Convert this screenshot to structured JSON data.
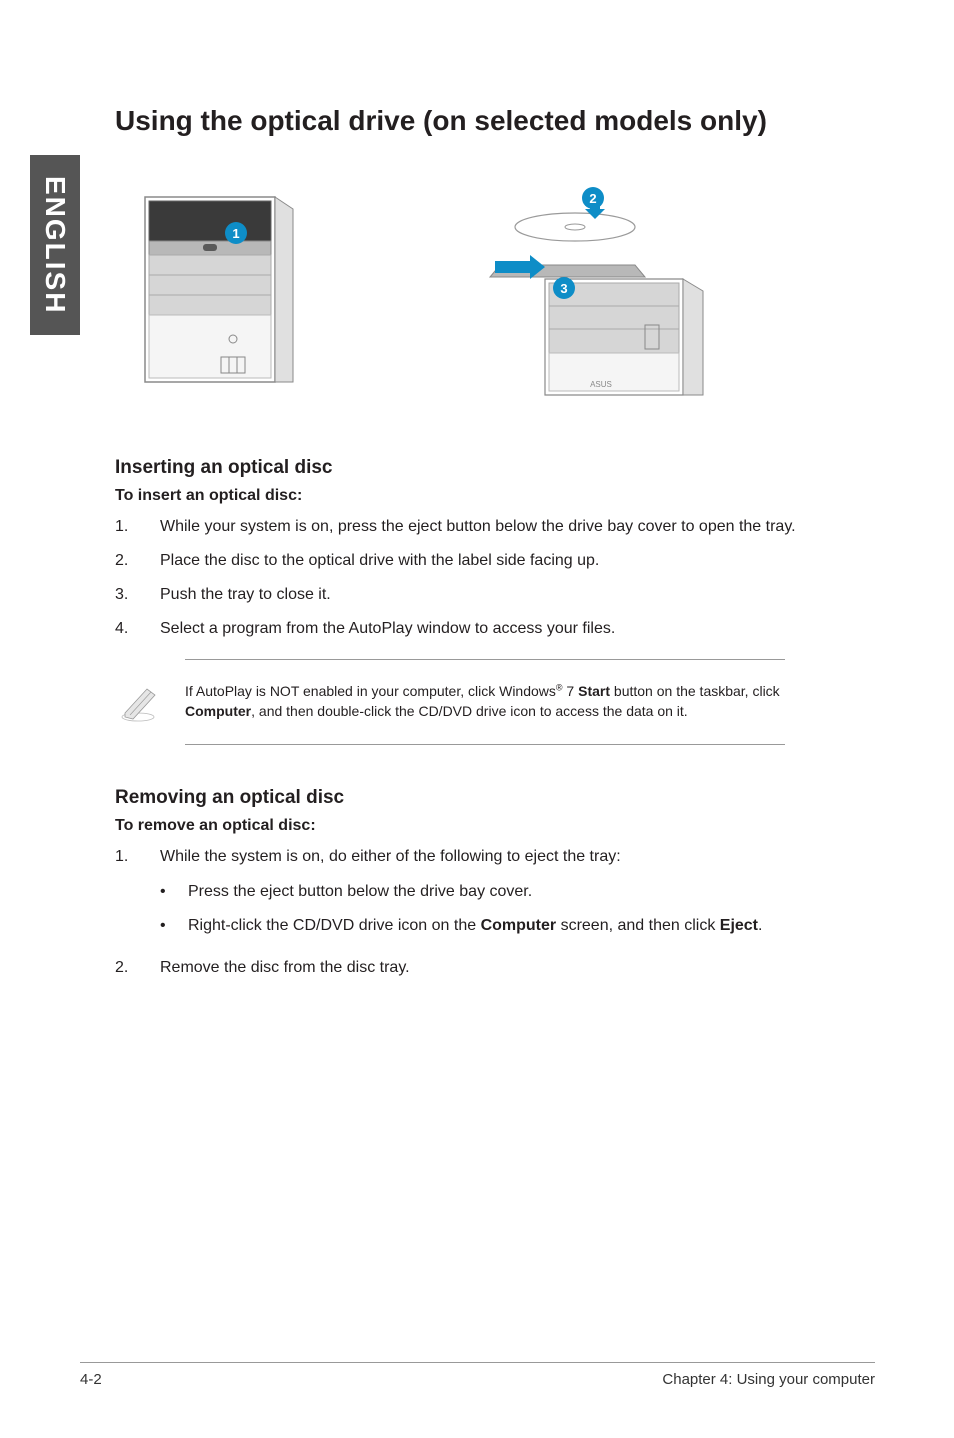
{
  "sideTab": "ENGLISH",
  "title": "Using the optical drive (on selected models only)",
  "callouts": {
    "c1": "1",
    "c2": "2",
    "c3": "3"
  },
  "insert": {
    "heading": "Inserting an optical disc",
    "sub": "To insert an optical disc:",
    "steps": [
      {
        "n": "1.",
        "t": "While your system is on, press the eject button below the drive bay cover to open the tray."
      },
      {
        "n": "2.",
        "t": "Place the disc to the optical drive with the label side facing up."
      },
      {
        "n": "3.",
        "t": "Push the tray to close it."
      },
      {
        "n": "4.",
        "t": "Select a program from the AutoPlay window to access your files."
      }
    ]
  },
  "note": {
    "pre": "If AutoPlay is NOT enabled in your computer, click Windows",
    "sup": "®",
    "mid1": " 7 ",
    "startWord": "Start",
    "mid2": " button on the taskbar, click ",
    "compWord": "Computer",
    "post": ", and then double-click the CD/DVD drive icon to access the data on it."
  },
  "remove": {
    "heading": "Removing an optical disc",
    "sub": "To remove an optical disc:",
    "step1n": "1.",
    "step1t": "While the system is on, do either of the following to eject the tray:",
    "bullets": {
      "b1": "Press the eject button below the drive bay cover.",
      "b2pre": "Right-click the CD/DVD drive icon on the ",
      "b2comp": "Computer",
      "b2mid": " screen, and then click ",
      "b2eject": "Eject",
      "b2post": "."
    },
    "step2n": "2.",
    "step2t": "Remove the disc from the disc tray."
  },
  "footer": {
    "left": "4-2",
    "right": "Chapter 4: Using your computer"
  }
}
